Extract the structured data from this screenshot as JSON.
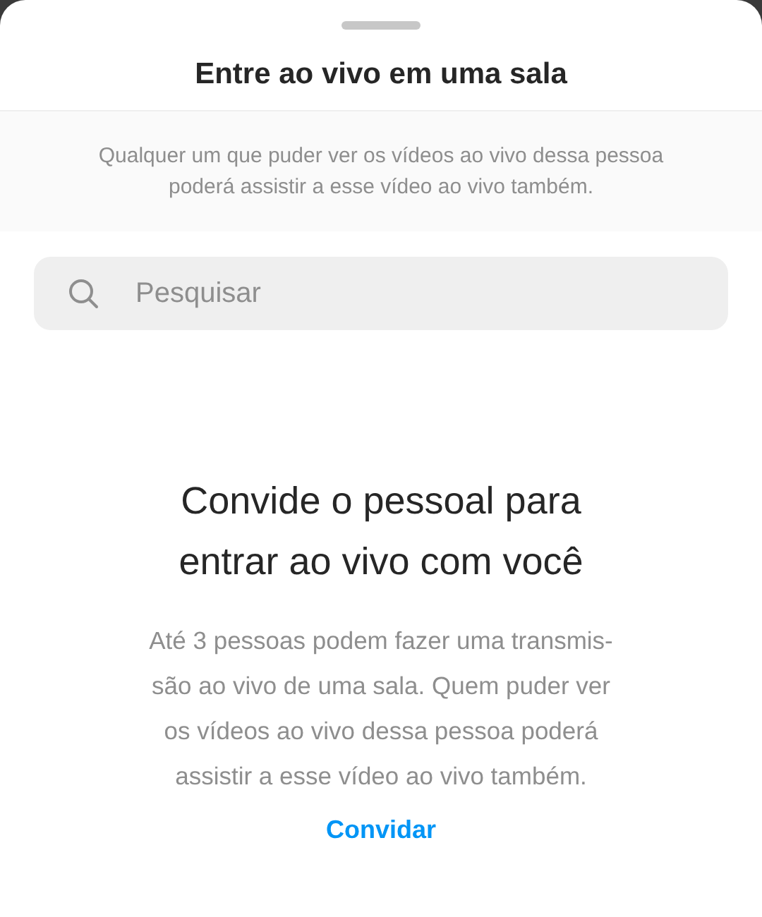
{
  "sheet": {
    "title": "Entre ao vivo em uma sala",
    "notice": [
      "Qualquer um que puder ver os vídeos ao vivo dessa pessoa",
      "poderá assistir a esse vídeo ao vivo também."
    ]
  },
  "search": {
    "placeholder": "Pesquisar"
  },
  "empty_state": {
    "heading": [
      "Convide o pessoal para",
      "entrar ao vivo com você"
    ],
    "body": [
      "Até 3 pessoas podem fazer uma transmis-",
      "são ao vivo de uma sala. Quem puder ver",
      "os vídeos ao vivo dessa pessoa poderá",
      "assistir a esse vídeo ao vivo também."
    ],
    "action": "Convidar"
  }
}
